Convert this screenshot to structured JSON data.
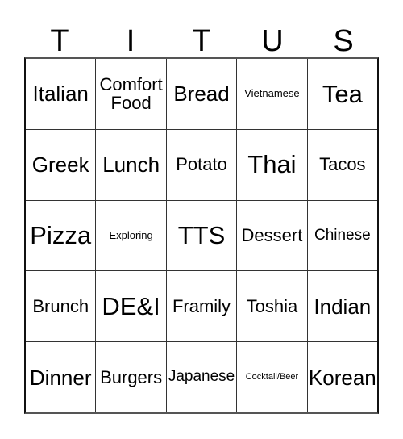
{
  "card": {
    "type": "bingo-card",
    "header": {
      "letters": [
        "T",
        "I",
        "T",
        "U",
        "S"
      ],
      "word": "TITUS"
    },
    "grid": {
      "columns": 5,
      "rows": 5,
      "cells": [
        [
          {
            "label": "Italian",
            "size": "lg"
          },
          {
            "label": "Comfort\nFood",
            "size": "md"
          },
          {
            "label": "Bread",
            "size": "lg"
          },
          {
            "label": "Vietnamese",
            "size": "xs"
          },
          {
            "label": "Tea",
            "size": "xl"
          }
        ],
        [
          {
            "label": "Greek",
            "size": "lg"
          },
          {
            "label": "Lunch",
            "size": "lg"
          },
          {
            "label": "Potato",
            "size": "md"
          },
          {
            "label": "Thai",
            "size": "xl"
          },
          {
            "label": "Tacos",
            "size": "md"
          }
        ],
        [
          {
            "label": "Pizza",
            "size": "xl"
          },
          {
            "label": "Exploring",
            "size": "xs"
          },
          {
            "label": "TTS",
            "size": "xl"
          },
          {
            "label": "Dessert",
            "size": "md"
          },
          {
            "label": "Chinese",
            "size": "sm"
          }
        ],
        [
          {
            "label": "Brunch",
            "size": "md"
          },
          {
            "label": "DE&I",
            "size": "xl"
          },
          {
            "label": "Framily",
            "size": "md"
          },
          {
            "label": "Toshia",
            "size": "md"
          },
          {
            "label": "Indian",
            "size": "lg"
          }
        ],
        [
          {
            "label": "Dinner",
            "size": "lg"
          },
          {
            "label": "Burgers",
            "size": "md"
          },
          {
            "label": "Japanese",
            "size": "sm"
          },
          {
            "label": "Cocktail/Beer",
            "size": "xxs"
          },
          {
            "label": "Korean",
            "size": "lg"
          }
        ]
      ]
    },
    "colors": {
      "background": "#ffffff",
      "text": "#000000",
      "grid_line": "#333333",
      "outer_border": "#111111"
    }
  }
}
